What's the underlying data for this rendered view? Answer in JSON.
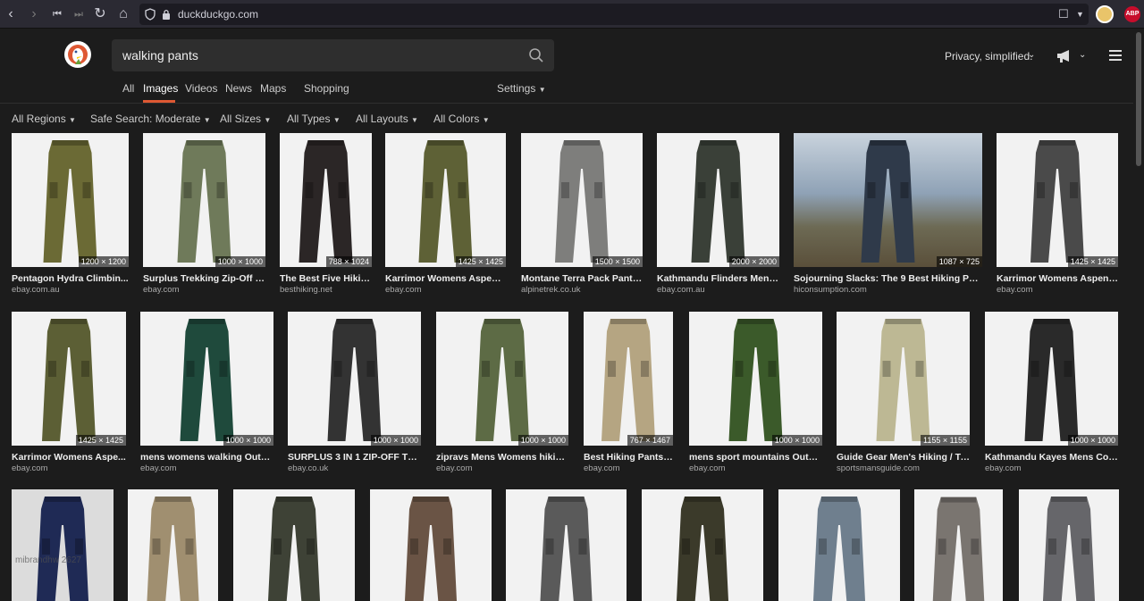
{
  "browser": {
    "url": "duckduckgo.com"
  },
  "header": {
    "query": "walking pants",
    "privacy_label": "Privacy, simplified.",
    "tabs": [
      "All",
      "Images",
      "Videos",
      "News",
      "Maps",
      "Shopping"
    ],
    "active_tab": "Images",
    "settings_label": "Settings"
  },
  "filters": [
    "All Regions",
    "Safe Search: Moderate",
    "All Sizes",
    "All Types",
    "All Layouts",
    "All Colors"
  ],
  "results": {
    "row1": [
      {
        "title": "Pentagon Hydra Climbin...",
        "source": "ebay.com.au",
        "dims": "1200 × 1200",
        "color": "#6b6a35"
      },
      {
        "title": "Surplus Trekking Zip-Off C...",
        "source": "ebay.com",
        "dims": "1000 × 1000",
        "color": "#6f7a5a"
      },
      {
        "title": "The Best Five Hikin...",
        "source": "besthiking.net",
        "dims": "788 × 1024",
        "color": "#2b2626"
      },
      {
        "title": "Karrimor Womens Aspen ...",
        "source": "ebay.com",
        "dims": "1425 × 1425",
        "color": "#5e6136"
      },
      {
        "title": "Montane Terra Pack Pants...",
        "source": "alpinetrek.co.uk",
        "dims": "1500 × 1500",
        "color": "#7e7e7c"
      },
      {
        "title": "Kathmandu Flinders Mens...",
        "source": "ebay.com.au",
        "dims": "2000 × 2000",
        "color": "#3a4038"
      },
      {
        "title": "Sojourning Slacks: The 9 Best Hiking Pant...",
        "source": "hiconsumption.com",
        "dims": "1087 × 725",
        "color": "#2f3a4a"
      },
      {
        "title": "Karrimor Womens Aspen ...",
        "source": "ebay.com",
        "dims": "1425 × 1425",
        "color": "#4a4a4a"
      }
    ],
    "row2": [
      {
        "title": "Karrimor Womens Aspe...",
        "source": "ebay.com",
        "dims": "1425 × 1425",
        "color": "#5c5f35"
      },
      {
        "title": "mens womens walking Outd...",
        "source": "ebay.com",
        "dims": "1000 × 1000",
        "color": "#1f4a3c"
      },
      {
        "title": "SURPLUS 3 IN 1 ZIP-OFF TR...",
        "source": "ebay.co.uk",
        "dims": "1000 × 1000",
        "color": "#333333"
      },
      {
        "title": "zipravs Mens Womens hiking...",
        "source": "ebay.com",
        "dims": "1000 × 1000",
        "color": "#5d6b45"
      },
      {
        "title": "Best Hiking Pants | ...",
        "source": "ebay.com",
        "dims": "767 × 1467",
        "color": "#b5a582"
      },
      {
        "title": "mens sport mountains Outdo...",
        "source": "ebay.com",
        "dims": "1000 × 1000",
        "color": "#3b5a2a"
      },
      {
        "title": "Guide Gear Men's Hiking / Tr...",
        "source": "sportsmansguide.com",
        "dims": "1155 × 1155",
        "color": "#bdb894"
      },
      {
        "title": "Kathmandu Kayes Mens Cott...",
        "source": "ebay.com",
        "dims": "1000 × 1000",
        "color": "#2a2a2a"
      }
    ],
    "row3": [
      {
        "color": "#1f2a55",
        "watermark": "mibrandhw 2627"
      },
      {
        "color": "#a08f70"
      },
      {
        "color": "#3e4236"
      },
      {
        "color": "#6a5445"
      },
      {
        "color": "#5a5a5a"
      },
      {
        "color": "#3b3a2a"
      },
      {
        "color": "#6f7f8e"
      },
      {
        "color": "#7a7570"
      },
      {
        "color": "#66666a"
      }
    ]
  }
}
